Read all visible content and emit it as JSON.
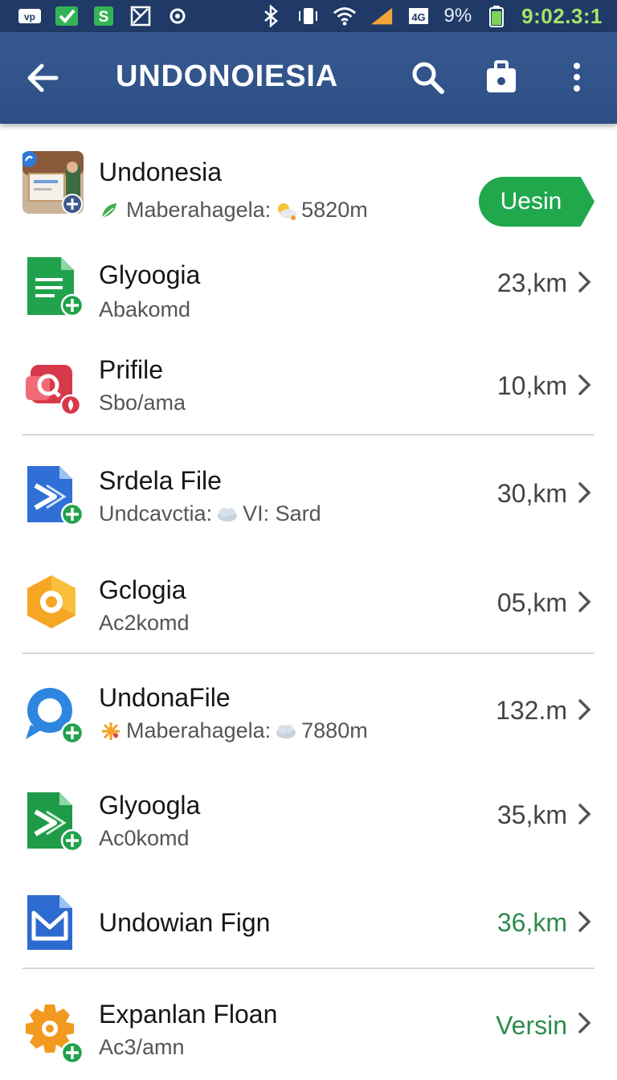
{
  "status_bar": {
    "battery_percent": "9%",
    "time": "9:02.3:1",
    "left_icons": [
      "vpn-icon",
      "check-icon",
      "dollar-icon",
      "gallery-icon",
      "dot-icon"
    ],
    "right_icons": [
      "bluetooth-icon",
      "vibrate-icon",
      "wifi-icon",
      "signal-icon",
      "data-icon",
      "battery-icon"
    ]
  },
  "app_bar": {
    "title": "UNDONOIESIA",
    "icons": [
      "back-arrow-icon",
      "search-icon",
      "briefcase-icon",
      "more-vert-icon"
    ]
  },
  "list": [
    {
      "icon": "photo-app-icon",
      "title": "Undonesia",
      "subtitle_a": "Maberahagela:",
      "subtitle_b": "5820m",
      "action": "Uesin"
    },
    {
      "icon": "sheets-doc-icon",
      "title": "Glyoogia",
      "subtitle": "Abakomd",
      "trail": "23,km"
    },
    {
      "icon": "red-app-icon",
      "title": "Prifile",
      "subtitle": "Sbo/ama",
      "trail": "10,km"
    },
    {
      "icon": "blue-file-icon",
      "title": "Srdela File",
      "subtitle_a": "Undcavctia:",
      "subtitle_b": "VI: Sard",
      "trail": "30,km"
    },
    {
      "icon": "yellow-hex-icon",
      "title": "Gclogia",
      "subtitle": "Ac2komd",
      "trail": "05,km"
    },
    {
      "icon": "chat-bubble-icon",
      "title": "UndonaFile",
      "subtitle_a": "Maberahagela:",
      "subtitle_b": "7880m",
      "trail": "132.m"
    },
    {
      "icon": "green-file-icon",
      "title": "Glyoogla",
      "subtitle": "Ac0komd",
      "trail": "35,km"
    },
    {
      "icon": "blue-doc-icon",
      "title": "Undowian Fign",
      "trail": "36,km"
    },
    {
      "icon": "gear-app-icon",
      "title": "Expanlan Floan",
      "subtitle": "Ac3/amn",
      "trail": "Versin"
    }
  ],
  "colors": {
    "status_bar": "#1f3a66",
    "app_bar": "#2d4f85",
    "accent_green": "#21a74c",
    "text_green": "#2e8b4c"
  }
}
